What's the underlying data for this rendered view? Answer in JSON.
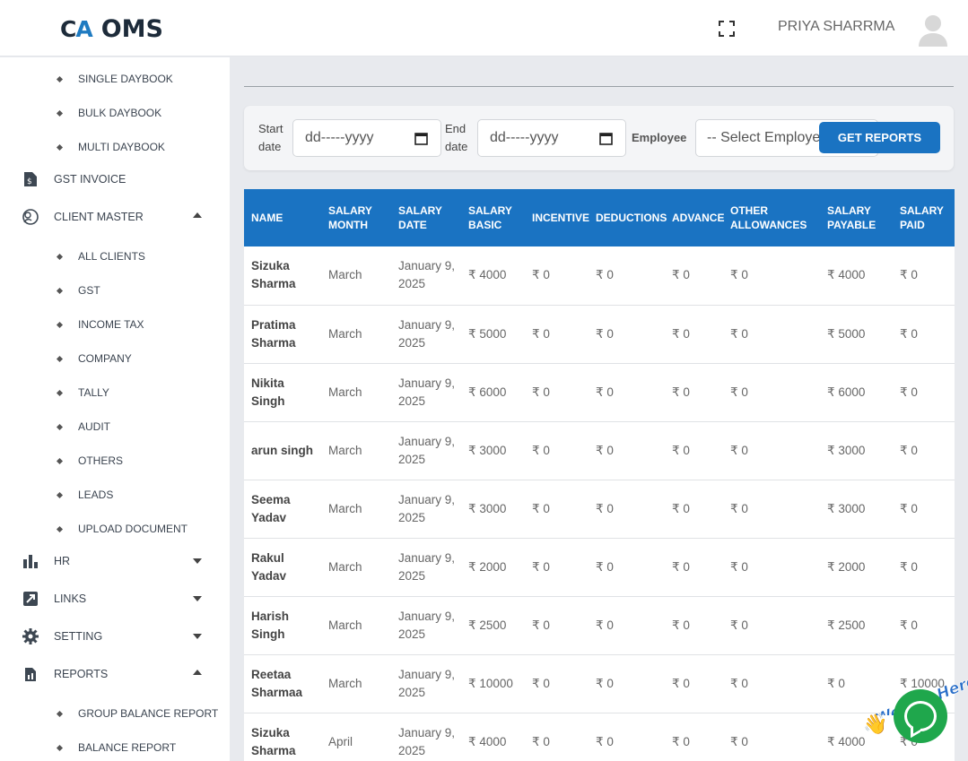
{
  "header": {
    "logo_mark_c": "C",
    "logo_mark_a": "A",
    "logo_text": "OMS",
    "user_name": "PRIYA SHARRMA"
  },
  "sidebar": {
    "items": [
      {
        "label": "SINGLE DAYBOOK",
        "type": "sub"
      },
      {
        "label": "BULK DAYBOOK",
        "type": "sub"
      },
      {
        "label": "MULTI DAYBOOK",
        "type": "sub"
      },
      {
        "label": "GST INVOICE",
        "type": "main",
        "icon": "invoice-icon"
      },
      {
        "label": "CLIENT MASTER",
        "type": "main",
        "icon": "client-icon",
        "caret": "up"
      },
      {
        "label": "ALL CLIENTS",
        "type": "sub"
      },
      {
        "label": "GST",
        "type": "sub"
      },
      {
        "label": "INCOME TAX",
        "type": "sub"
      },
      {
        "label": "COMPANY",
        "type": "sub"
      },
      {
        "label": "TALLY",
        "type": "sub"
      },
      {
        "label": "AUDIT",
        "type": "sub"
      },
      {
        "label": "OTHERS",
        "type": "sub"
      },
      {
        "label": "LEADS",
        "type": "sub"
      },
      {
        "label": "UPLOAD DOCUMENT",
        "type": "sub"
      },
      {
        "label": "HR",
        "type": "main",
        "icon": "bar-chart-icon",
        "caret": "down"
      },
      {
        "label": "LINKS",
        "type": "main",
        "icon": "external-link-icon",
        "caret": "down"
      },
      {
        "label": "SETTING",
        "type": "main",
        "icon": "gear-icon",
        "caret": "down"
      },
      {
        "label": "REPORTS",
        "type": "main",
        "icon": "report-icon",
        "caret": "up"
      },
      {
        "label": "GROUP BALANCE REPORT",
        "type": "sub"
      },
      {
        "label": "BALANCE REPORT",
        "type": "sub"
      }
    ]
  },
  "filters": {
    "start_label_1": "Start",
    "start_label_2": "date",
    "start_value": "dd-----yyyy",
    "end_label_1": "End",
    "end_label_2": "date",
    "end_value": "dd-----yyyy",
    "employee_label": "Employee",
    "employee_value": "-- Select Employee --",
    "button_label": "GET REPORTS"
  },
  "table": {
    "headers": [
      [
        "NAME"
      ],
      [
        "SALARY",
        "MONTH"
      ],
      [
        "SALARY",
        "DATE"
      ],
      [
        "SALARY",
        "BASIC"
      ],
      [
        "INCENTIVE"
      ],
      [
        "DEDUCTIONS"
      ],
      [
        "ADVANCE"
      ],
      [
        "OTHER",
        "ALLOWANCES"
      ],
      [
        "SALARY",
        "PAYABLE"
      ],
      [
        "SALARY",
        "PAID"
      ]
    ],
    "rows": [
      [
        "Sizuka Sharma",
        "March",
        "January 9, 2025",
        "₹ 4000",
        "₹ 0",
        "₹ 0",
        "₹ 0",
        "₹ 0",
        "₹ 4000",
        "₹ 0"
      ],
      [
        "Pratima Sharma",
        "March",
        "January 9, 2025",
        "₹ 5000",
        "₹ 0",
        "₹ 0",
        "₹ 0",
        "₹ 0",
        "₹ 5000",
        "₹ 0"
      ],
      [
        "Nikita Singh",
        "March",
        "January 9, 2025",
        "₹ 6000",
        "₹ 0",
        "₹ 0",
        "₹ 0",
        "₹ 0",
        "₹ 6000",
        "₹ 0"
      ],
      [
        "arun singh",
        "March",
        "January 9, 2025",
        "₹ 3000",
        "₹ 0",
        "₹ 0",
        "₹ 0",
        "₹ 0",
        "₹ 3000",
        "₹ 0"
      ],
      [
        "Seema Yadav",
        "March",
        "January 9, 2025",
        "₹ 3000",
        "₹ 0",
        "₹ 0",
        "₹ 0",
        "₹ 0",
        "₹ 3000",
        "₹ 0"
      ],
      [
        "Rakul Yadav",
        "March",
        "January 9, 2025",
        "₹ 2000",
        "₹ 0",
        "₹ 0",
        "₹ 0",
        "₹ 0",
        "₹ 2000",
        "₹ 0"
      ],
      [
        "Harish Singh",
        "March",
        "January 9, 2025",
        "₹ 2500",
        "₹ 0",
        "₹ 0",
        "₹ 0",
        "₹ 0",
        "₹ 2500",
        "₹ 0"
      ],
      [
        "Reetaa Sharmaa",
        "March",
        "January 9, 2025",
        "₹ 10000",
        "₹ 0",
        "₹ 0",
        "₹ 0",
        "₹ 0",
        "₹ 0",
        "₹ 10000"
      ],
      [
        "Sizuka Sharma",
        "April",
        "January 9, 2025",
        "₹ 4000",
        "₹ 0",
        "₹ 0",
        "₹ 0",
        "₹ 0",
        "₹ 4000",
        "₹ 0"
      ]
    ]
  },
  "chat_widget": {
    "label": "We Are Here!",
    "accent": "#1fa74c"
  },
  "colors": {
    "primary": "#1a73c2",
    "background": "#e8eaee"
  }
}
